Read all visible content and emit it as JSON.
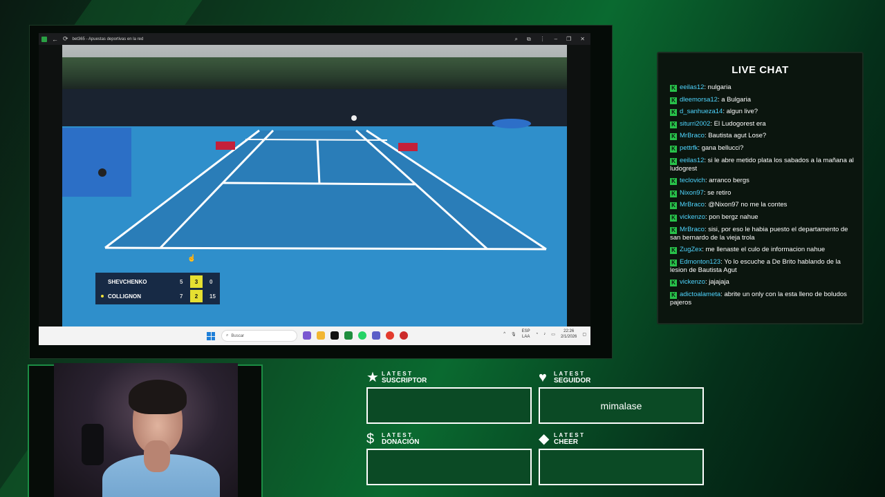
{
  "browser": {
    "tab_title": "bet365 - Apuestas deportivas en la red",
    "taskbar": {
      "search_placeholder": "Buscar",
      "lang_top": "ESP",
      "lang_bottom": "LAA",
      "time": "22:26",
      "date": "2/1/2026"
    }
  },
  "scoreboard": {
    "players": [
      {
        "name": "SHEVCHENKO",
        "set1": "5",
        "set2": "3",
        "points": "0",
        "serving": false
      },
      {
        "name": "COLLIGNON",
        "set1": "7",
        "set2": "2",
        "points": "15",
        "serving": true
      }
    ],
    "highlight_color": "#e6e031"
  },
  "chat": {
    "title": "LIVE CHAT",
    "messages": [
      {
        "user": "eeilas12",
        "text": "nulgaria"
      },
      {
        "user": "dleemorsa12",
        "text": "a Bulgaria"
      },
      {
        "user": "d_sanhueza14",
        "text": "algun live?"
      },
      {
        "user": "siturri2002",
        "text": "El Ludogorest era"
      },
      {
        "user": "MrBraco",
        "text": "Bautista agut Lose?"
      },
      {
        "user": "pettrfk",
        "text": "gana bellucci?"
      },
      {
        "user": "eeilas12",
        "text": "si le abre metido plata los sabados a la mañana al ludogrest"
      },
      {
        "user": "teclovich",
        "text": "arranco bergs"
      },
      {
        "user": "Nixon97",
        "text": "se retiro"
      },
      {
        "user": "MrBraco",
        "text": "@Nixon97 no me la contes"
      },
      {
        "user": "vickenzo",
        "text": "pon bergz nahue"
      },
      {
        "user": "MrBraco",
        "text": "sisi, por eso le habia puesto el departamento de san bernardo de la vieja trola"
      },
      {
        "user": "ZugZex",
        "text": "me llenaste el culo de informacion nahue"
      },
      {
        "user": "Edmonton123",
        "text": "Yo lo escuche a De Brito hablando de la lesion de Bautista Agut"
      },
      {
        "user": "vickenzo",
        "text": "jajajaja"
      },
      {
        "user": "adictoalameta",
        "text": "abrite un only con la esta lleno de boludos pajeros"
      }
    ],
    "user_color": "#4fd5ff",
    "badge_color": "#28c24a"
  },
  "widgets": {
    "suscriptor": {
      "small": "LATEST",
      "big": "SUSCRIPTOR",
      "value": "",
      "icon": "star-icon"
    },
    "seguidor": {
      "small": "LATEST",
      "big": "SEGUIDOR",
      "value": "mimalase",
      "icon": "heart-icon"
    },
    "donacion": {
      "small": "LATEST",
      "big": "DONACIÓN",
      "value": "",
      "icon": "dollar-icon"
    },
    "cheer": {
      "small": "LATEST",
      "big": "CHEER",
      "value": "",
      "icon": "diamond-icon"
    }
  },
  "theme": {
    "accent": "#1c8d44",
    "background": "#0a5a2a"
  }
}
